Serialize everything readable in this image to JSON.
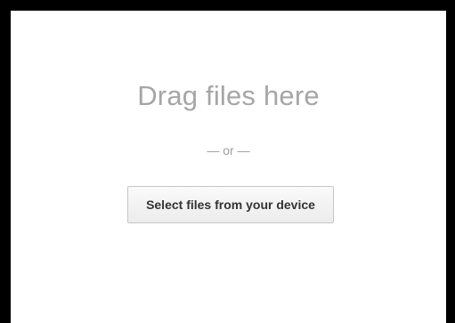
{
  "upload": {
    "drag_title": "Drag files here",
    "or_divider": "— or —",
    "select_button_label": "Select files from your device"
  },
  "colors": {
    "title_text": "#a6a6a6",
    "divider_text": "#9e9e9e",
    "button_text": "#333333",
    "button_border": "#c6c6c6",
    "frame_border": "#000000"
  }
}
